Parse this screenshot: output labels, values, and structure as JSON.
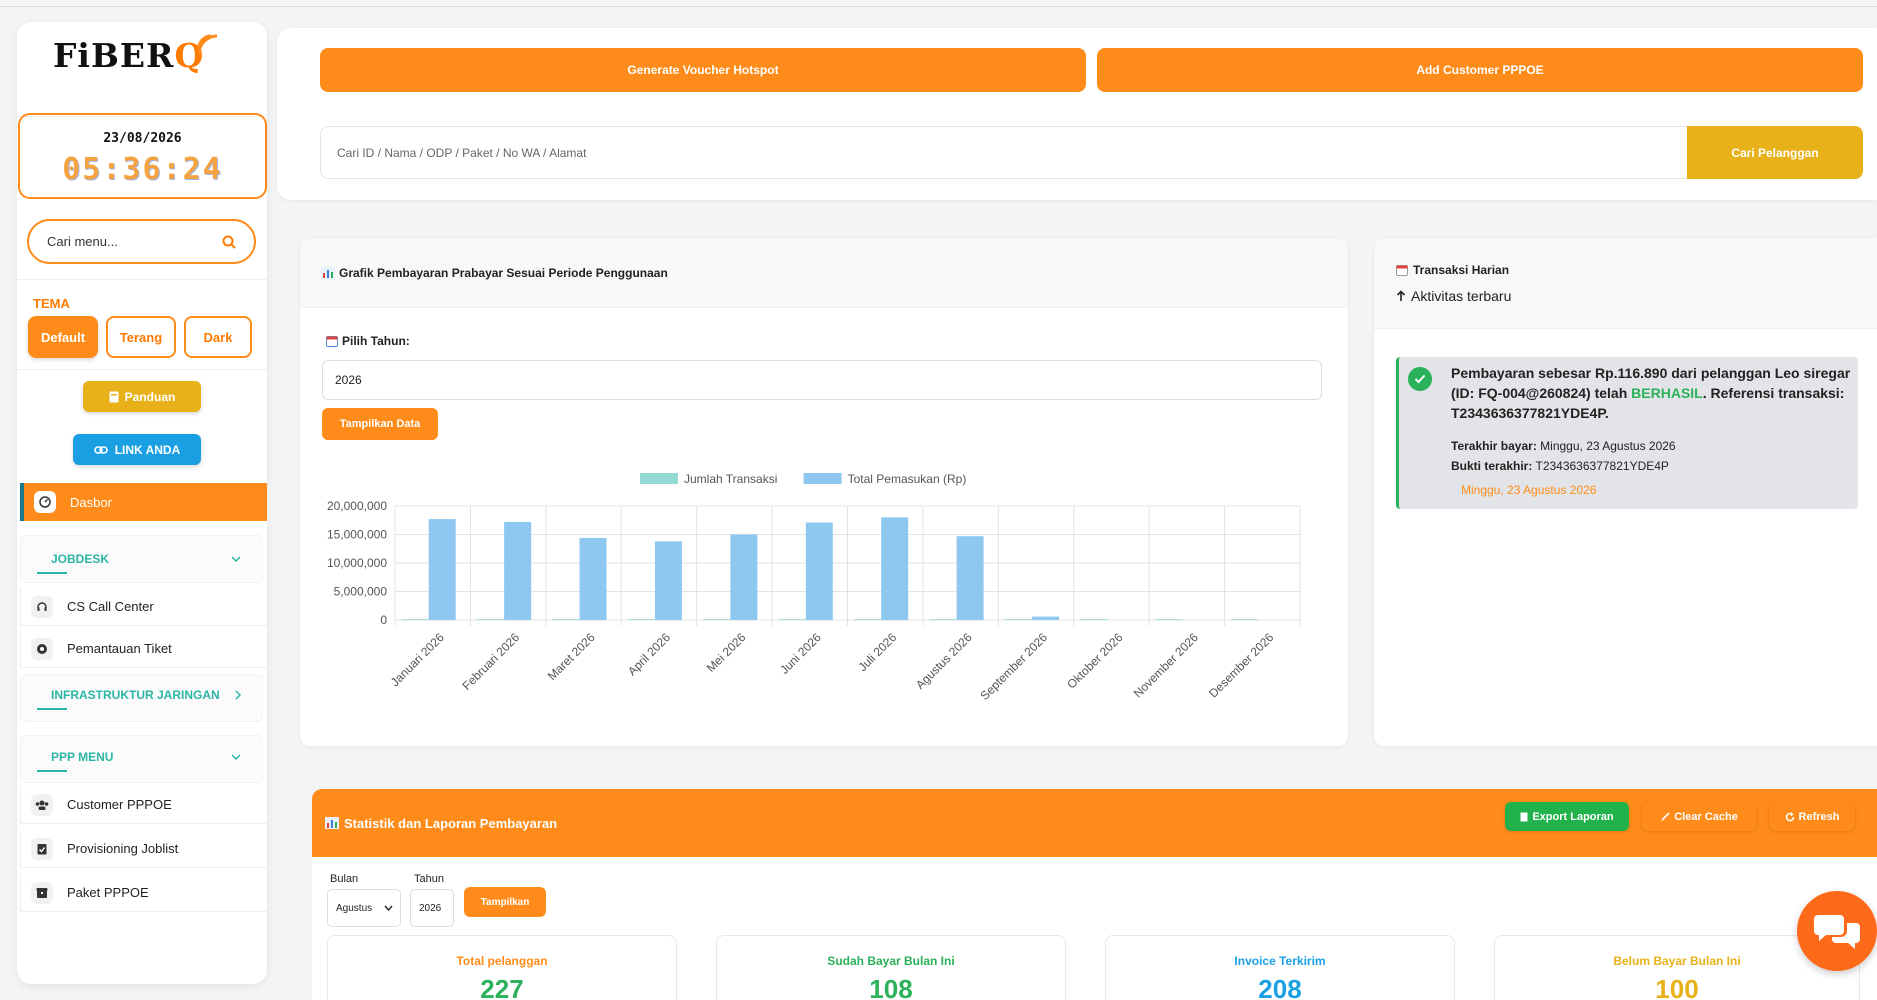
{
  "app": {
    "logo_text": "FiBERQ"
  },
  "clock": {
    "date": "23/08/2026",
    "time": "05:36:24"
  },
  "sidebar": {
    "search_placeholder": "Cari menu...",
    "tema_label": "TEMA",
    "tema_options": [
      "Default",
      "Terang",
      "Dark"
    ],
    "panduan": "Panduan",
    "link_anda": "LINK ANDA",
    "dasbor": "Dasbor",
    "sections": {
      "jobdesk": "JOBDESK",
      "infra": "INFRASTRUKTUR JARINGAN",
      "ppp": "PPP MENU"
    },
    "items": {
      "cs": "CS Call Center",
      "tiket": "Pemantauan Tiket",
      "customer": "Customer PPPOE",
      "provisioning": "Provisioning Joblist",
      "paket": "Paket PPPOE"
    }
  },
  "top": {
    "voucher": "Generate Voucher Hotspot",
    "add_customer": "Add Customer PPPOE",
    "search_placeholder": "Cari ID / Nama / ODP / Paket / No WA / Alamat",
    "search_button": "Cari Pelanggan"
  },
  "chart_card": {
    "title": "Grafik Pembayaran Prabayar Sesuai Periode Penggunaan",
    "pilih_label": "Pilih Tahun:",
    "year_value": "2026",
    "show_button": "Tampilkan Data"
  },
  "chart_data": {
    "type": "bar",
    "categories": [
      "Januari 2026",
      "Februari 2026",
      "Maret 2026",
      "April 2026",
      "Mei 2026",
      "Juni 2026",
      "Juli 2026",
      "Agustus 2026",
      "September 2026",
      "Oktober 2026",
      "November 2026",
      "Desember 2026"
    ],
    "series": [
      {
        "name": "Jumlah Transaksi",
        "values": [
          110,
          105,
          95,
          92,
          100,
          112,
          115,
          108,
          4,
          0,
          0,
          0
        ],
        "color": "#93d9d4"
      },
      {
        "name": "Total Pemasukan (Rp)",
        "values": [
          17700000,
          17200000,
          14400000,
          13800000,
          15000000,
          17100000,
          18000000,
          14700000,
          600000,
          0,
          0,
          0
        ],
        "color": "#8ec8f0"
      }
    ],
    "ylim": [
      0,
      20000000
    ],
    "yticks": [
      "0",
      "5,000,000",
      "10,000,000",
      "15,000,000",
      "20,000,000"
    ],
    "grid": true,
    "legend": "top"
  },
  "trx": {
    "title": "Transaksi Harian",
    "subtitle": "Aktivitas terbaru",
    "msg_part1": "Pembayaran sebesar Rp.116.890 dari pelanggan Leo siregar (ID: FQ-004@260824) telah ",
    "msg_ok": "BERHASIL",
    "msg_part2": ". Referensi transaksi: T2343636377821YDE4P.",
    "last_pay_label": "Terakhir bayar:",
    "last_pay_value": "Minggu, 23 Agustus 2026",
    "proof_label": "Bukti terakhir:",
    "proof_value": "T2343636377821YDE4P",
    "date": "Minggu, 23 Agustus 2026"
  },
  "stats": {
    "title": "Statistik dan Laporan Pembayaran",
    "export": "Export Laporan",
    "clear": "Clear Cache",
    "refresh": "Refresh",
    "bulan_label": "Bulan",
    "bulan_value": "Agustus",
    "tahun_label": "Tahun",
    "tahun_value": "2026",
    "show": "Tampilkan",
    "cards": [
      {
        "label": "Total pelanggan",
        "value": "227",
        "color": "#ff8c1a",
        "valcolor": "#2bb15a"
      },
      {
        "label": "Sudah Bayar Bulan Ini",
        "value": "108",
        "color": "#2bb15a",
        "valcolor": "#2bb15a"
      },
      {
        "label": "Invoice Terkirim",
        "value": "208",
        "color": "#1a9fe3",
        "valcolor": "#1a9fe3"
      },
      {
        "label": "Belum Bayar Bulan Ini",
        "value": "100",
        "color": "#e8b119",
        "valcolor": "#e8b119"
      }
    ]
  }
}
